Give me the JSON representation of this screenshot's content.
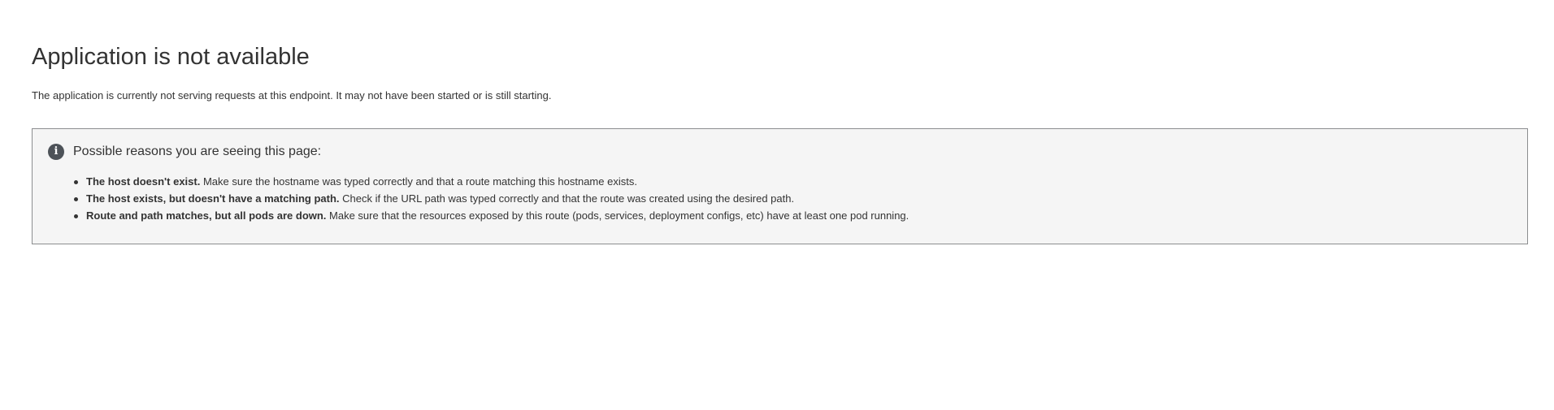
{
  "page": {
    "title": "Application is not available",
    "subtitle": "The application is currently not serving requests at this endpoint. It may not have been started or is still starting."
  },
  "alert": {
    "icon": "info-icon",
    "icon_glyph": "i",
    "heading": "Possible reasons you are seeing this page:",
    "reasons": [
      {
        "title": "The host doesn't exist.",
        "text": " Make sure the hostname was typed correctly and that a route matching this hostname exists."
      },
      {
        "title": "The host exists, but doesn't have a matching path.",
        "text": " Check if the URL path was typed correctly and that the route was created using the desired path."
      },
      {
        "title": "Route and path matches, but all pods are down.",
        "text": " Make sure that the resources exposed by this route (pods, services, deployment configs, etc) have at least one pod running."
      }
    ]
  },
  "colors": {
    "text": "#333333",
    "alert_background": "#f5f5f5",
    "alert_border": "#8b8d8f",
    "icon_background": "#4d5258"
  }
}
